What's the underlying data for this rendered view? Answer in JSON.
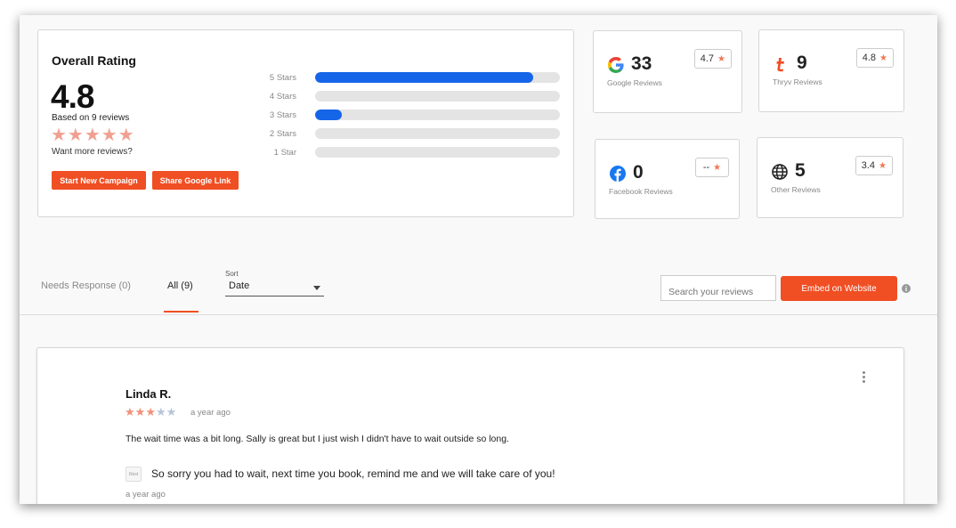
{
  "overall": {
    "title": "Overall Rating",
    "score": "4.8",
    "based_on": "Based on 9 reviews",
    "stars": "★★★★★",
    "want_more": "Want more reviews?",
    "start_campaign_label": "Start New Campaign",
    "share_google_label": "Share Google Link",
    "distribution": [
      {
        "label": "5 Stars",
        "fraction": 0.89
      },
      {
        "label": "4 Stars",
        "fraction": 0.0
      },
      {
        "label": "3 Stars",
        "fraction": 0.11
      },
      {
        "label": "2 Stars",
        "fraction": 0.0
      },
      {
        "label": "1 Star",
        "fraction": 0.0
      }
    ],
    "bar_color": "#1565e8"
  },
  "sources": {
    "google": {
      "count": "33",
      "label": "Google Reviews",
      "rating": "4.7",
      "icon": "google-icon"
    },
    "thryv": {
      "count": "9",
      "label": "Thryv Reviews",
      "rating": "4.8",
      "icon": "thryv-icon"
    },
    "facebook": {
      "count": "0",
      "label": "Facebook Reviews",
      "rating": "--",
      "icon": "facebook-icon"
    },
    "other": {
      "count": "5",
      "label": "Other Reviews",
      "rating": "3.4",
      "icon": "globe-icon"
    }
  },
  "filters": {
    "needs_response_label": "Needs Response (0)",
    "all_label": "All (9)",
    "sort_label": "Sort",
    "sort_value": "Date",
    "search_placeholder": "Search your reviews",
    "embed_label": "Embed on Website",
    "info_glyph": "i"
  },
  "review": {
    "name": "Linda R.",
    "rating": 3,
    "time": "a year ago",
    "text": "The wait time was a bit long. Sally is great but I just wish I didn't have to wait outside so long.",
    "reply_logo_text": "Rest",
    "reply_text": "So sorry you had to wait, next time you book, remind me and we will take care of you!",
    "reply_time": "a year ago"
  },
  "colors": {
    "accent": "#f04e23",
    "star": "#f0907a",
    "star_off": "#b8c4d8"
  }
}
